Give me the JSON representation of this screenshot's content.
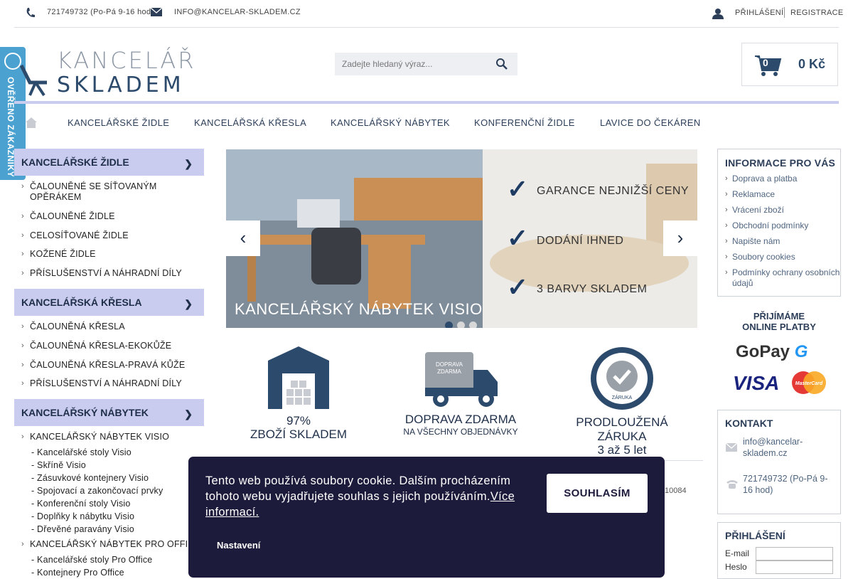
{
  "topbar": {
    "phone": "721749732 (Po-Pá 9-16 hod)",
    "email": "info@kancelar-skladem.cz",
    "login": "PŘIHLÁŠENÍ",
    "register": "REGISTRACE"
  },
  "logo": {
    "line1": "KANCELÁŘ",
    "line2": "SKLADEM"
  },
  "search": {
    "placeholder": "Zadejte hledaný výraz..."
  },
  "cart": {
    "count": "0",
    "total": "0 Kč"
  },
  "nav": [
    "KANCELÁŘSKÉ ŽIDLE",
    "KANCELÁŘSKÁ KŘESLA",
    "KANCELÁŘSKÝ NÁBYTEK",
    "KONFERENČNÍ ŽIDLE",
    "LAVICE DO ČEKÁREN"
  ],
  "badge": {
    "text": "OVĚŘENO ZÁKAZNÍKY"
  },
  "sidebar": {
    "cat1": {
      "title": "KANCELÁŘSKÉ ŽIDLE",
      "items": [
        "ČALOUNĚNÉ SE SÍŤOVANÝM OPĚRÁKEM",
        "ČALOUNĚNÉ ŽIDLE",
        "CELOSÍŤOVANÉ ŽIDLE",
        "KOŽENÉ ŽIDLE",
        "PŘÍSLUŠENSTVÍ A NÁHRADNÍ DÍLY"
      ]
    },
    "cat2": {
      "title": "KANCELÁŘSKÁ KŘESLA",
      "items": [
        "ČALOUNĚNÁ KŘESLA",
        "ČALOUNĚNÁ KŘESLA-EKOKŮŽE",
        "ČALOUNĚNÁ KŘESLA-PRAVÁ KŮŽE",
        "PŘÍSLUŠENSTVÍ A NÁHRADNÍ DÍLY"
      ]
    },
    "cat3": {
      "title": "KANCELÁŘSKÝ NÁBYTEK",
      "visio": "KANCELÁŘSKÝ NÁBYTEK VISIO",
      "visio_items": [
        "- Kancelářské stoly Visio",
        "- Skříně Visio",
        "- Zásuvkové kontejnery Visio",
        "- Spojovací a zakončovací prvky",
        "- Konferenční stoly Visio",
        "- Doplňky k nábytku Visio",
        "- Dřevěné paravány Visio"
      ],
      "pro": "KANCELÁŘSKÝ NÁBYTEK PRO OFFICE",
      "pro_items": [
        "- Kancelářské stoly Pro Office",
        "- Kontejnery Pro Office"
      ]
    }
  },
  "slider": {
    "caption": "KANCELÁŘSKÝ NÁBYTEK VISIO",
    "g1": "GARANCE NEJNIŽŠÍ CENY",
    "g2": "DODÁNÍ IHNED",
    "g3": "3 BARVY SKLADEM",
    "prev": "‹",
    "next": "›"
  },
  "features": {
    "f1": {
      "t1": "97%",
      "t2": "ZBOŽÍ SKLADEM"
    },
    "f2": {
      "badge": "DOPRAVA ZDARMA",
      "t1": "DOPRAVA ZDARMA",
      "t2": "NA VŠECHNY OBJEDNÁVKY"
    },
    "f3": {
      "badge": "ZÁRUKA",
      "t1": "PRODLOUŽENÁ ZÁRUKA",
      "t2": "3 až 5 let"
    }
  },
  "behind_text": "10084",
  "info": {
    "title": "INFORMACE PRO VÁS",
    "items": [
      "Doprava a platba",
      "Reklamace",
      "Vrácení zboží",
      "Obchodní podmínky",
      "Napište nám",
      "Soubory cookies",
      "Podmínky ochrany osobních údajů"
    ]
  },
  "payments": {
    "title1": "PŘIJÍMÁME",
    "title2": "ONLINE PLATBY",
    "gopay": "GoPay",
    "visa": "VISA",
    "mc": "MasterCard"
  },
  "contact": {
    "title": "KONTAKT",
    "email": "info@kancelar-skladem.cz",
    "phone": "721749732 (Po-Pá 9-16 hod)"
  },
  "login": {
    "title": "PŘIHLÁŠENÍ",
    "email_label": "E-mail",
    "pass_label": "Heslo"
  },
  "cookie": {
    "text": "Tento web používá soubory cookie. Dalším procházením tohoto webu vyjadřujete souhlas s jejich používáním.",
    "more": "Více informací.",
    "agree": "SOUHLASÍM",
    "settings": "Nastavení"
  },
  "colors": {
    "accent": "#c9ccee",
    "navy": "#1f2f49",
    "badge": "#4ba1d0",
    "cookie_bg": "#1d1b3b"
  }
}
